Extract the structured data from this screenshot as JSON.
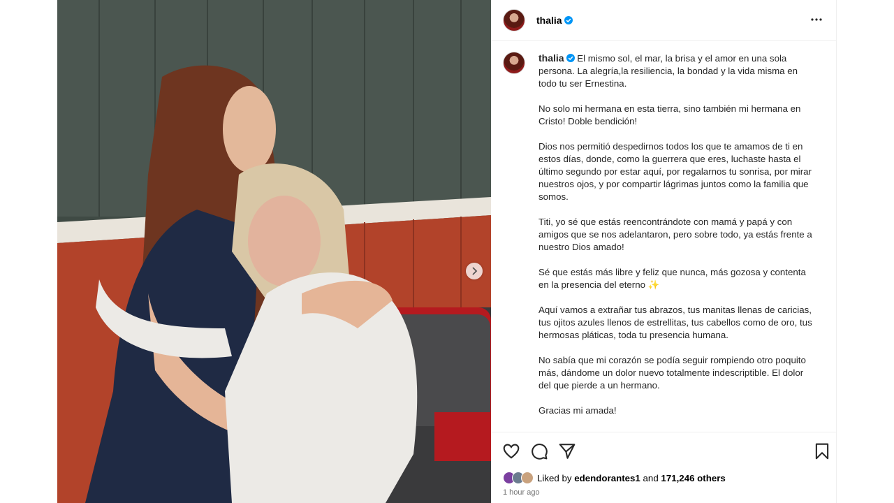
{
  "post": {
    "username": "thalia",
    "caption_paragraphs": [
      "El mismo sol, el mar, la brisa y el amor en una sola persona. La alegría,la resiliencia, la bondad y la vida misma en todo tu ser Ernestina.",
      "No solo mi hermana en esta tierra, sino también mi hermana en Cristo! Doble bendición!",
      "Dios nos permitió despedirnos todos los que te amamos de ti en estos días, donde, como la guerrera que eres, luchaste hasta el último segundo por estar aquí, por regalarnos tu sonrisa, por mirar nuestros ojos, y por compartir lágrimas juntos como la familia que somos.",
      "Titi, yo sé que estás reencontrándote con mamá y papá y con amigos que se nos adelantaron, pero sobre todo, ya estás frente a nuestro Dios amado!",
      "Sé que estás más libre y feliz que nunca, más gozosa y contenta en la presencia del eterno ✨",
      "Aquí vamos a extrañar tus abrazos, tus manitas llenas de caricias, tus ojitos azules llenos de estrellitas, tus cabellos como de oro, tus hermosas pláticas, toda tu presencia humana.",
      "No sabía que mi corazón se podía seguir rompiendo otro poquito más, dándome un dolor nuevo totalmente indescriptible. El dolor del que pierde a un hermano.",
      "Gracias mi amada!"
    ],
    "likes": {
      "prefix": "Liked by",
      "user": "edendorantes1",
      "joiner": "and",
      "others": "171,246 others"
    },
    "timestamp": "1 hour ago",
    "icons": {
      "verified": "verified-badge-icon",
      "more": "more-options-icon",
      "like": "heart-icon",
      "comment": "comment-icon",
      "share": "share-icon",
      "save": "bookmark-icon",
      "next": "chevron-right-icon"
    },
    "colors": {
      "verified": "#0095f6",
      "text": "#262626",
      "muted": "#737373",
      "border": "#efefef"
    }
  }
}
